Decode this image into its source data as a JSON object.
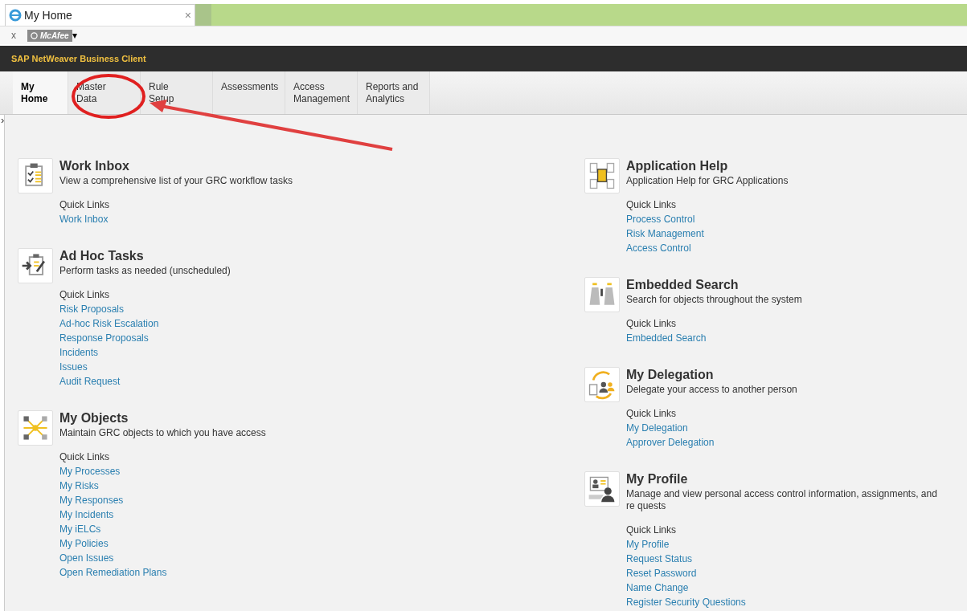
{
  "browser": {
    "tab": {
      "title": "My Home",
      "close": "×"
    },
    "toolbar": {
      "close": "x",
      "addon": "McAfee",
      "caret": "▾"
    }
  },
  "app": {
    "title": "SAP NetWeaver Business Client"
  },
  "tabs": [
    {
      "label": "My\nHome",
      "selected": true
    },
    {
      "label": "Master\nData",
      "selected": false
    },
    {
      "label": "Rule\nSetup",
      "selected": false
    },
    {
      "label": "Assessments",
      "selected": false
    },
    {
      "label": "Access\nManagement",
      "selected": false
    },
    {
      "label": "Reports and\nAnalytics",
      "selected": false
    }
  ],
  "expand_toggle": "›",
  "columns": [
    [
      {
        "kind": "checklist",
        "title": "Work Inbox",
        "description": "View a comprehensive list of your GRC workflow tasks",
        "quick_links_label": "Quick Links",
        "links": [
          "Work Inbox"
        ]
      },
      {
        "kind": "tasks",
        "title": "Ad Hoc Tasks",
        "description": "Perform tasks as needed (unscheduled)",
        "quick_links_label": "Quick Links",
        "links": [
          "Risk Proposals",
          "Ad-hoc Risk Escalation",
          "Response Proposals",
          "Incidents",
          "Issues",
          "Audit Request"
        ]
      },
      {
        "kind": "objects",
        "title": "My Objects",
        "description": "Maintain GRC objects to which you have access",
        "quick_links_label": "Quick Links",
        "links": [
          "My Processes",
          "My Risks",
          "My Responses",
          "My Incidents",
          "My iELCs",
          "My Policies",
          "Open Issues",
          "Open Remediation Plans"
        ]
      }
    ],
    [
      {
        "kind": "help",
        "title": "Application Help",
        "description": "Application Help for GRC Applications",
        "quick_links_label": "Quick Links",
        "links": [
          "Process Control",
          "Risk Management",
          "Access Control"
        ]
      },
      {
        "kind": "binoculars",
        "title": "Embedded Search",
        "description": "Search for objects throughout the system",
        "quick_links_label": "Quick Links",
        "links": [
          "Embedded Search"
        ]
      },
      {
        "kind": "delegation",
        "title": "My Delegation",
        "description": "Delegate your access to another person",
        "quick_links_label": "Quick Links",
        "links": [
          "My Delegation",
          "Approver Delegation"
        ]
      },
      {
        "kind": "profile",
        "title": "My Profile",
        "description": "Manage and view personal access control information, assignments, and re quests",
        "quick_links_label": "Quick Links",
        "links": [
          "My Profile",
          "Request Status",
          "Reset Password",
          "Name Change",
          "Register Security Questions"
        ]
      }
    ]
  ]
}
